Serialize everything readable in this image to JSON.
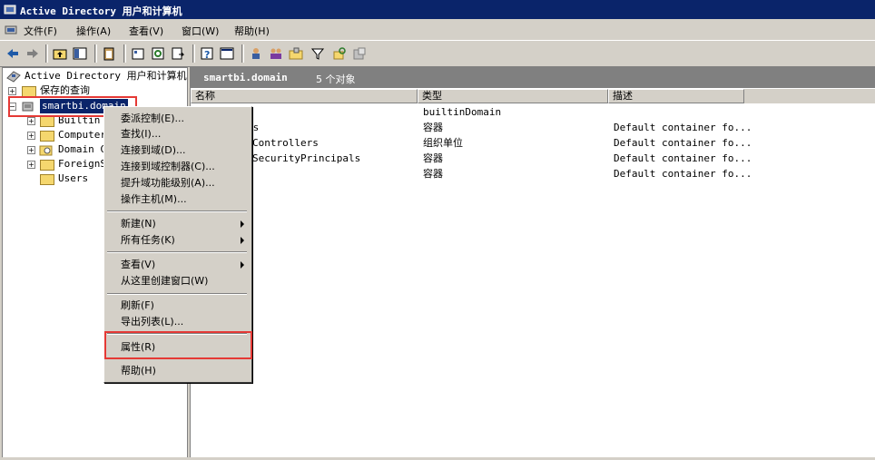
{
  "window": {
    "title": "Active Directory 用户和计算机"
  },
  "menubar": [
    "文件(F)",
    "操作(A)",
    "查看(V)",
    "窗口(W)",
    "帮助(H)"
  ],
  "tree": {
    "root": "Active Directory 用户和计算机",
    "saved_queries": "保存的查询",
    "domain": "smartbi.domain",
    "children": [
      "Builtin",
      "Computer",
      "Domain C",
      "ForeignS",
      "Users"
    ]
  },
  "rightpane": {
    "title": "smartbi.domain",
    "count": "5 个对象",
    "columns": [
      "名称",
      "类型",
      "描述"
    ],
    "rows": [
      {
        "name": "",
        "type": "builtinDomain",
        "desc": ""
      },
      {
        "name": "rs",
        "type": "容器",
        "desc": "Default container fo..."
      },
      {
        "name": "Controllers",
        "type": "组织单位",
        "desc": "Default container fo..."
      },
      {
        "name": "SecurityPrincipals",
        "type": "容器",
        "desc": "Default container fo..."
      },
      {
        "name": "",
        "type": "容器",
        "desc": "Default container fo..."
      }
    ]
  },
  "context_menu": {
    "delegate": "委派控制(E)...",
    "find": "查找(I)...",
    "connect_domain": "连接到域(D)...",
    "connect_dc": "连接到域控制器(C)...",
    "raise_level": "提升域功能级别(A)...",
    "ops_master": "操作主机(M)...",
    "new": "新建(N)",
    "all_tasks": "所有任务(K)",
    "view": "查看(V)",
    "new_window": "从这里创建窗口(W)",
    "refresh": "刷新(F)",
    "export": "导出列表(L)...",
    "properties": "属性(R)",
    "help": "帮助(H)"
  },
  "colors": {
    "titlebar": "#0a246a",
    "highlight_box": "#e53935",
    "menu_bg": "#d4d0c8"
  }
}
